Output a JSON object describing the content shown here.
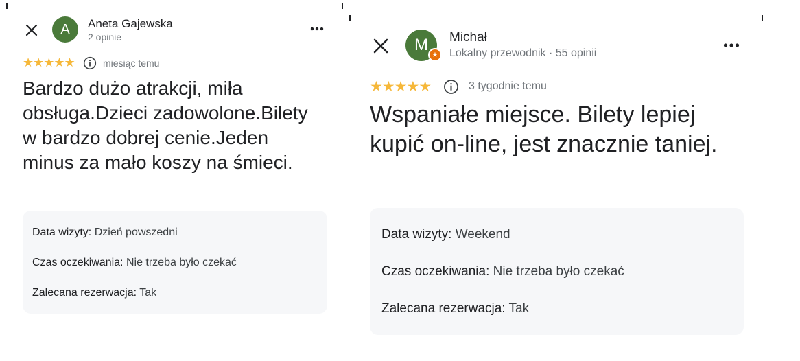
{
  "left": {
    "avatar_letter": "A",
    "author": "Aneta Gajewska",
    "author_subtitle": "2 opinie",
    "rating_stars": "★★★★★",
    "rating": 5,
    "time": "miesiąc temu",
    "review_text": "Bardzo dużo atrakcji, miła obsługa.Dzieci zadowolone.Bilety w bardzo dobrej cenie.Jeden minus za mało koszy na śmieci.",
    "details": [
      {
        "label": "Data wizyty:",
        "value": "Dzień powszedni"
      },
      {
        "label": "Czas oczekiwania:",
        "value": "Nie trzeba było czekać"
      },
      {
        "label": "Zalecana rezerwacja:",
        "value": "Tak"
      }
    ]
  },
  "right": {
    "avatar_letter": "M",
    "badge_symbol": "★",
    "author": "Michał",
    "author_subtitle": "Lokalny przewodnik · 55 opinii",
    "rating_stars": "★★★★★",
    "rating": 5,
    "time": "3 tygodnie temu",
    "review_text": "Wspaniałe miejsce. Bilety lepiej kupić on-line, jest znacznie taniej.",
    "details": [
      {
        "label": "Data wizyty:",
        "value": "Weekend"
      },
      {
        "label": "Czas oczekiwania:",
        "value": "Nie trzeba było czekać"
      },
      {
        "label": "Zalecana rezerwacja:",
        "value": "Tak"
      }
    ]
  },
  "colors": {
    "star": "#f6b83a",
    "avatar": "#4a7a3a",
    "badge": "#e8710a",
    "details_bg": "#f6f7f9",
    "muted_text": "#70757a"
  },
  "icons": [
    "close-icon",
    "more-vert-icon",
    "info-icon",
    "local-guide-star-icon"
  ]
}
